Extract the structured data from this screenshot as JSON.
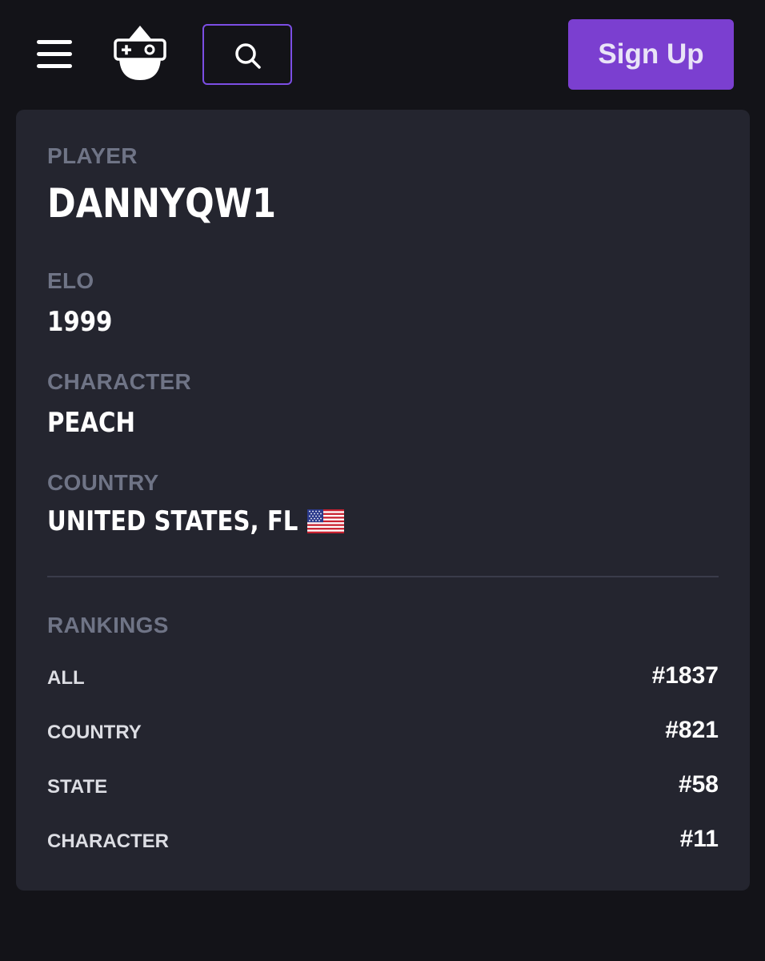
{
  "header": {
    "menu_icon": "hamburger-menu-icon",
    "logo_icon": "gamepad-mascot-logo",
    "search_icon": "search-icon",
    "signup_label": "Sign Up",
    "accent_color": "#7b3fd0"
  },
  "profile": {
    "player_label": "PLAYER",
    "player_name": "DANNYQW1",
    "elo_label": "ELO",
    "elo_value": "1999",
    "character_label": "CHARACTER",
    "character_value": "PEACH",
    "country_label": "COUNTRY",
    "country_value": "UNITED STATES, FL",
    "country_flag_icon": "us-flag-icon"
  },
  "rankings": {
    "title": "RANKINGS",
    "rows": [
      {
        "label": "ALL",
        "value": "#1837"
      },
      {
        "label": "COUNTRY",
        "value": "#821"
      },
      {
        "label": "STATE",
        "value": "#58"
      },
      {
        "label": "CHARACTER",
        "value": "#11"
      }
    ]
  }
}
